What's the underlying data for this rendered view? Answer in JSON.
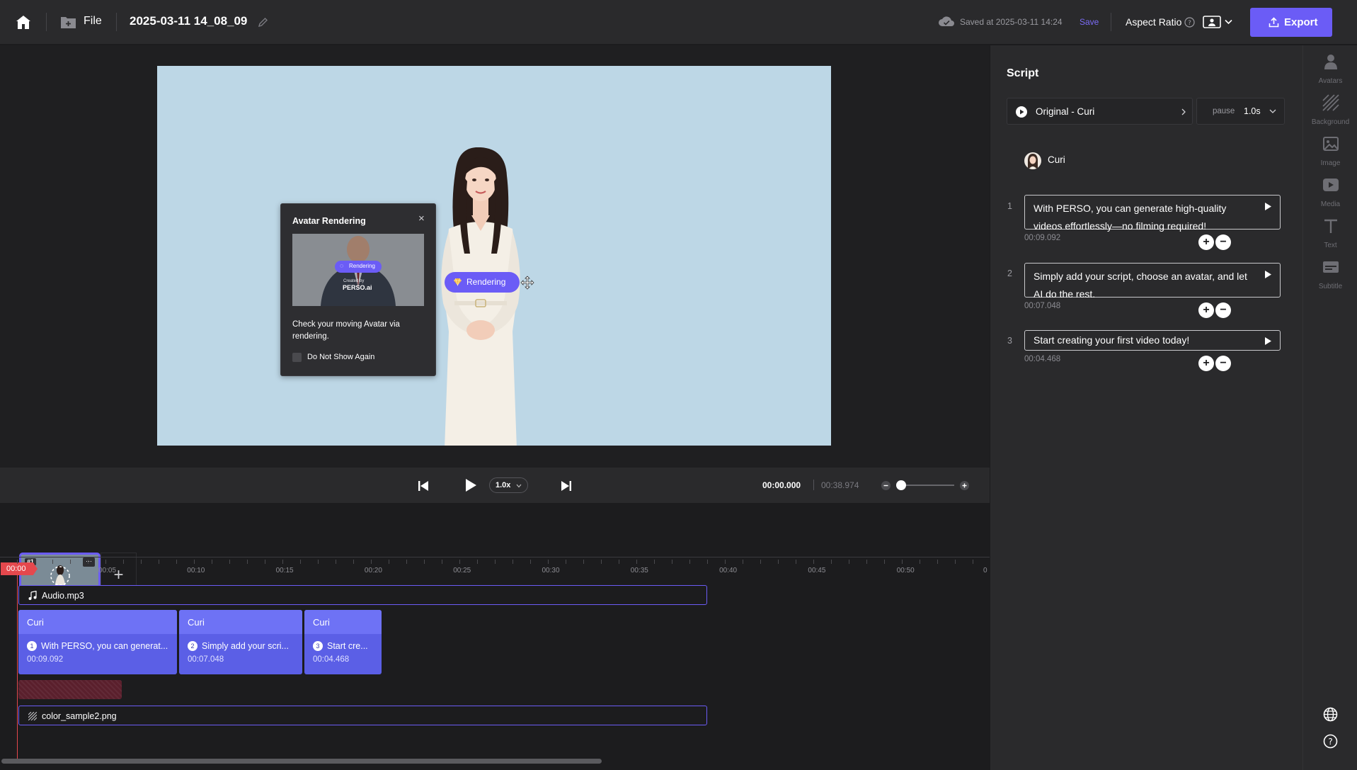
{
  "header": {
    "file_label": "File",
    "project_title": "2025-03-11 14_08_09",
    "saved_text": "Saved at 2025-03-11 14:24",
    "save_label": "Save",
    "aspect_ratio_label": "Aspect Ratio",
    "export_label": "Export"
  },
  "popup": {
    "title": "Avatar Rendering",
    "preview_badge": "Rendering",
    "preview_created_by": "Created by",
    "preview_brand": "PERSO.ai",
    "message": "Check your moving Avatar via rendering.",
    "checkbox_label": "Do Not Show Again"
  },
  "canvas": {
    "rendering_label": "Rendering"
  },
  "controls": {
    "speed": "1.0x",
    "current_time": "00:00.000",
    "total_time": "00:38.974"
  },
  "scenes": {
    "scene_badge": "#1",
    "menu_glyph": "···",
    "add_glyph": "+"
  },
  "timeline": {
    "playhead": "00:00",
    "ticks": [
      "00:05",
      "00:10",
      "00:15",
      "00:20",
      "00:25",
      "00:30",
      "00:35",
      "00:40",
      "00:45",
      "00:50",
      "0"
    ],
    "audio_track": "Audio.mp3",
    "image_track": "color_sample2.png",
    "clips": [
      {
        "speaker": "Curi",
        "num": "1",
        "text": "With PERSO, you can generat...",
        "duration": "00:09.092"
      },
      {
        "speaker": "Curi",
        "num": "2",
        "text": "Simply add your scri...",
        "duration": "00:07.048"
      },
      {
        "speaker": "Curi",
        "num": "3",
        "text": "Start cre...",
        "duration": "00:04.468"
      }
    ]
  },
  "script": {
    "title": "Script",
    "voice_selector": "Original - Curi",
    "pause_label": "pause",
    "pause_value": "1.0s",
    "speaker_name": "Curi",
    "lines": [
      {
        "num": "1",
        "text": "With PERSO, you can generate high-quality videos effortlessly—no filming required!",
        "duration": "00:09.092"
      },
      {
        "num": "2",
        "text": "Simply add your script, choose an avatar, and let AI do the rest.",
        "duration": "00:07.048"
      },
      {
        "num": "3",
        "text": "Start creating your first video today!",
        "duration": "00:04.468"
      }
    ]
  },
  "rail": {
    "items": [
      {
        "label": "Avatars",
        "icon": "avatar-icon"
      },
      {
        "label": "Background",
        "icon": "background-icon"
      },
      {
        "label": "Image",
        "icon": "image-icon"
      },
      {
        "label": "Media",
        "icon": "media-icon"
      },
      {
        "label": "Text",
        "icon": "text-icon"
      },
      {
        "label": "Subtitle",
        "icon": "subtitle-icon"
      }
    ]
  },
  "colors": {
    "accent": "#6b5cf6",
    "clip_blue": "#5b5fe6",
    "playhead_red": "#e5484d",
    "canvas_bg": "#bdd7e6"
  }
}
